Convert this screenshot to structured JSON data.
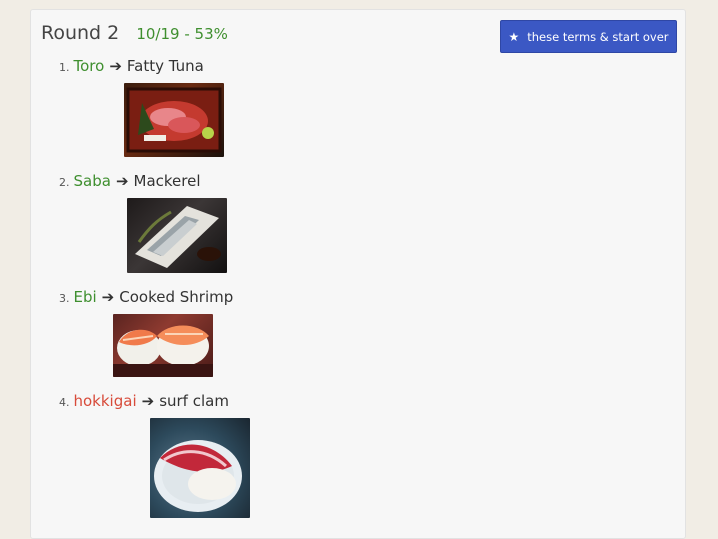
{
  "header": {
    "round_label": "Round 2",
    "score": "10/19 - 53%",
    "restart_button": "these terms & start over",
    "restart_icon": "star-icon"
  },
  "items": [
    {
      "number": "1.",
      "term": "Toro",
      "status": "correct",
      "definition": "Fatty Tuna"
    },
    {
      "number": "2.",
      "term": "Saba",
      "status": "correct",
      "definition": "Mackerel"
    },
    {
      "number": "3.",
      "term": "Ebi",
      "status": "correct",
      "definition": "Cooked Shrimp"
    },
    {
      "number": "4.",
      "term": "hokkigai",
      "status": "incorrect",
      "definition": "surf clam"
    }
  ],
  "arrow": "➔",
  "colors": {
    "correct": "#3f8f2f",
    "incorrect": "#d84b3a",
    "button": "#3b58c4",
    "panel": "#f7f7f7",
    "page": "#f1ede5"
  }
}
